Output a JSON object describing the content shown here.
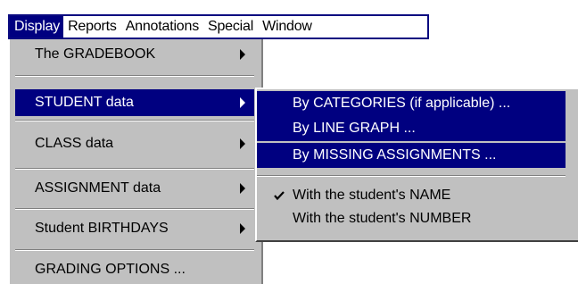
{
  "menubar": {
    "items": [
      {
        "label": "Display",
        "active": true
      },
      {
        "label": "Reports"
      },
      {
        "label": "Annotations"
      },
      {
        "label": "Special"
      },
      {
        "label": "Window"
      }
    ]
  },
  "display_menu": {
    "items": [
      {
        "label": "The GRADEBOOK",
        "has_submenu": true
      },
      {
        "label": "STUDENT data",
        "has_submenu": true,
        "active": true
      },
      {
        "label": "CLASS data",
        "has_submenu": true
      },
      {
        "label": "ASSIGNMENT data",
        "has_submenu": true
      },
      {
        "label": "Student BIRTHDAYS",
        "has_submenu": true
      },
      {
        "label": "GRADING OPTIONS ..."
      }
    ]
  },
  "student_submenu": {
    "items": [
      {
        "label": "By CATEGORIES (if applicable) ..."
      },
      {
        "label": "By LINE GRAPH ..."
      },
      {
        "label": "By MISSING ASSIGNMENTS ..."
      },
      {
        "label": "With the student's NAME",
        "checked": true
      },
      {
        "label": "With the student's NUMBER"
      }
    ]
  },
  "colors": {
    "highlight": "#000080",
    "menu_face": "#c0c0c0",
    "highlight_text": "#ffffff"
  }
}
